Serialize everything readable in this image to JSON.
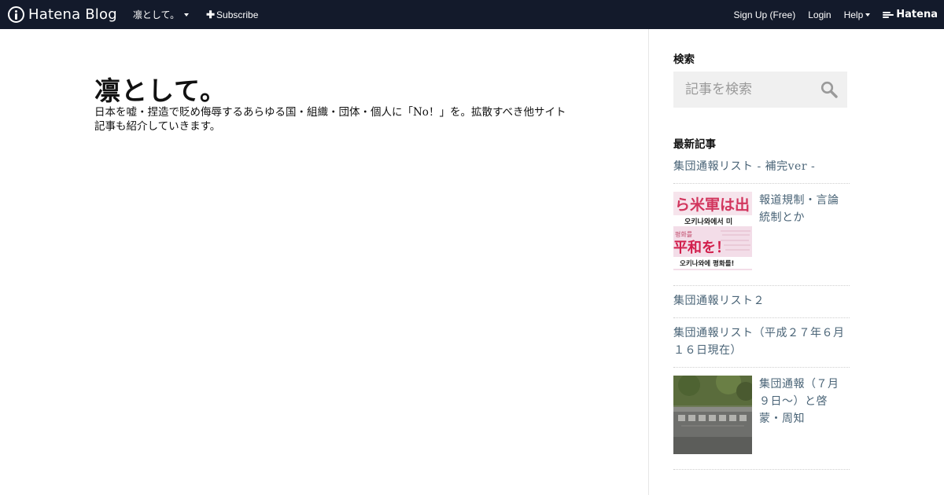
{
  "topbar": {
    "brand": "Hatena Blog",
    "blog_name": "凛として。",
    "subscribe": "Subscribe",
    "signup": "Sign Up (Free)",
    "login": "Login",
    "help": "Help",
    "hatena": "Hatena"
  },
  "blog": {
    "title": "凛として。",
    "description": "日本を嘘・捏造で貶め侮辱するあらゆる国・組織・団体・個人に「No！」を。拡散すべき他サイト記事も紹介していきます。"
  },
  "sidebar": {
    "search_title": "検索",
    "search_placeholder": "記事を検索",
    "recent_title": "最新記事",
    "recent": [
      {
        "title": "集団通報リスト - 補完ver -"
      },
      {
        "title": "報道規制・言論統制とか",
        "thumb": "protest-sign-thumbnail"
      },
      {
        "title": "集団通報リスト２"
      },
      {
        "title": "集団通報リスト（平成２７年６月１６日現在）"
      },
      {
        "title": "集団通報（７月９日〜）と啓蒙・周知",
        "thumb": "stone-monument-thumbnail"
      }
    ]
  },
  "thumb1": {
    "line1": "ら米軍は出",
    "line2": "오키나와에서 미",
    "line3": "평화를",
    "line4": "平和を！",
    "line5": "오키나와에 평화를!"
  },
  "colors": {
    "topbar": "#131a2b",
    "link": "#4a6477",
    "search_bg": "#f0f0f0"
  }
}
